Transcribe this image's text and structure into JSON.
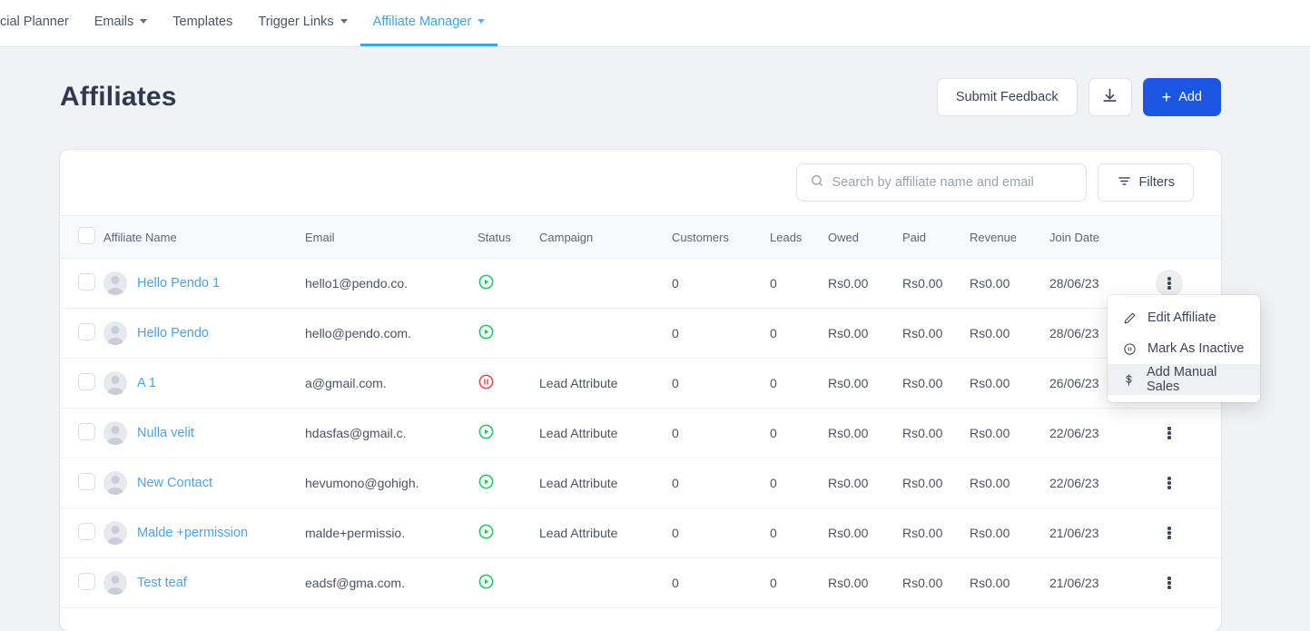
{
  "nav": {
    "items": [
      {
        "label": "cial Planner",
        "has_caret": false,
        "active": false
      },
      {
        "label": "Emails",
        "has_caret": true,
        "active": false
      },
      {
        "label": "Templates",
        "has_caret": false,
        "active": false
      },
      {
        "label": "Trigger Links",
        "has_caret": true,
        "active": false
      },
      {
        "label": "Affiliate Manager",
        "has_caret": true,
        "active": true
      }
    ],
    "active_color": "#3ca5e8"
  },
  "header": {
    "title": "Affiliates",
    "submit_feedback_label": "Submit Feedback",
    "download_icon": "download-icon",
    "add_label": "Add",
    "add_plus": "+",
    "primary_color": "#1c57e3"
  },
  "toolbar": {
    "search_placeholder": "Search by affiliate name and email",
    "search_value": "",
    "search_icon": "search-icon",
    "filters_label": "Filters",
    "filters_icon": "filter-icon"
  },
  "table": {
    "columns": [
      "Affiliate Name",
      "Email",
      "Status",
      "Campaign",
      "Customers",
      "Leads",
      "Owed",
      "Paid",
      "Revenue",
      "Join Date"
    ],
    "rows": [
      {
        "name": "Hello Pendo 1",
        "email": "hello1@pendo.co.",
        "status": "active",
        "campaign": "",
        "customers": "0",
        "leads": "0",
        "owed": "Rs0.00",
        "paid": "Rs0.00",
        "revenue": "Rs0.00",
        "join_date": "28/06/23",
        "menu_open": true
      },
      {
        "name": "Hello Pendo",
        "email": "hello@pendo.com.",
        "status": "active",
        "campaign": "",
        "customers": "0",
        "leads": "0",
        "owed": "Rs0.00",
        "paid": "Rs0.00",
        "revenue": "Rs0.00",
        "join_date": "28/06/23",
        "menu_open": false
      },
      {
        "name": "A 1",
        "email": "a@gmail.com.",
        "status": "paused",
        "campaign": "Lead Attribute",
        "customers": "0",
        "leads": "0",
        "owed": "Rs0.00",
        "paid": "Rs0.00",
        "revenue": "Rs0.00",
        "join_date": "26/06/23",
        "menu_open": false
      },
      {
        "name": "Nulla velit",
        "email": "hdasfas@gmail.c.",
        "status": "active",
        "campaign": "Lead Attribute",
        "customers": "0",
        "leads": "0",
        "owed": "Rs0.00",
        "paid": "Rs0.00",
        "revenue": "Rs0.00",
        "join_date": "22/06/23",
        "menu_open": false
      },
      {
        "name": "New Contact",
        "email": "hevumono@gohigh.",
        "status": "active",
        "campaign": "Lead Attribute",
        "customers": "0",
        "leads": "0",
        "owed": "Rs0.00",
        "paid": "Rs0.00",
        "revenue": "Rs0.00",
        "join_date": "22/06/23",
        "menu_open": false
      },
      {
        "name": "Malde +permission",
        "email": "malde+permissio.",
        "status": "active",
        "campaign": "Lead Attribute",
        "customers": "0",
        "leads": "0",
        "owed": "Rs0.00",
        "paid": "Rs0.00",
        "revenue": "Rs0.00",
        "join_date": "21/06/23",
        "menu_open": false
      },
      {
        "name": "Test teaf",
        "email": "eadsf@gma.com.",
        "status": "active",
        "campaign": "",
        "customers": "0",
        "leads": "0",
        "owed": "Rs0.00",
        "paid": "Rs0.00",
        "revenue": "Rs0.00",
        "join_date": "21/06/23",
        "menu_open": false
      }
    ],
    "status_colors": {
      "active": "#22c55e",
      "paused": "#ef4444"
    }
  },
  "context_menu": {
    "items": [
      {
        "label": "Edit Affiliate",
        "icon": "pencil-icon",
        "hover": false
      },
      {
        "label": "Mark As Inactive",
        "icon": "pause-circle-icon",
        "hover": false
      },
      {
        "label": "Add Manual Sales",
        "icon": "dollar-icon",
        "hover": true
      }
    ]
  }
}
